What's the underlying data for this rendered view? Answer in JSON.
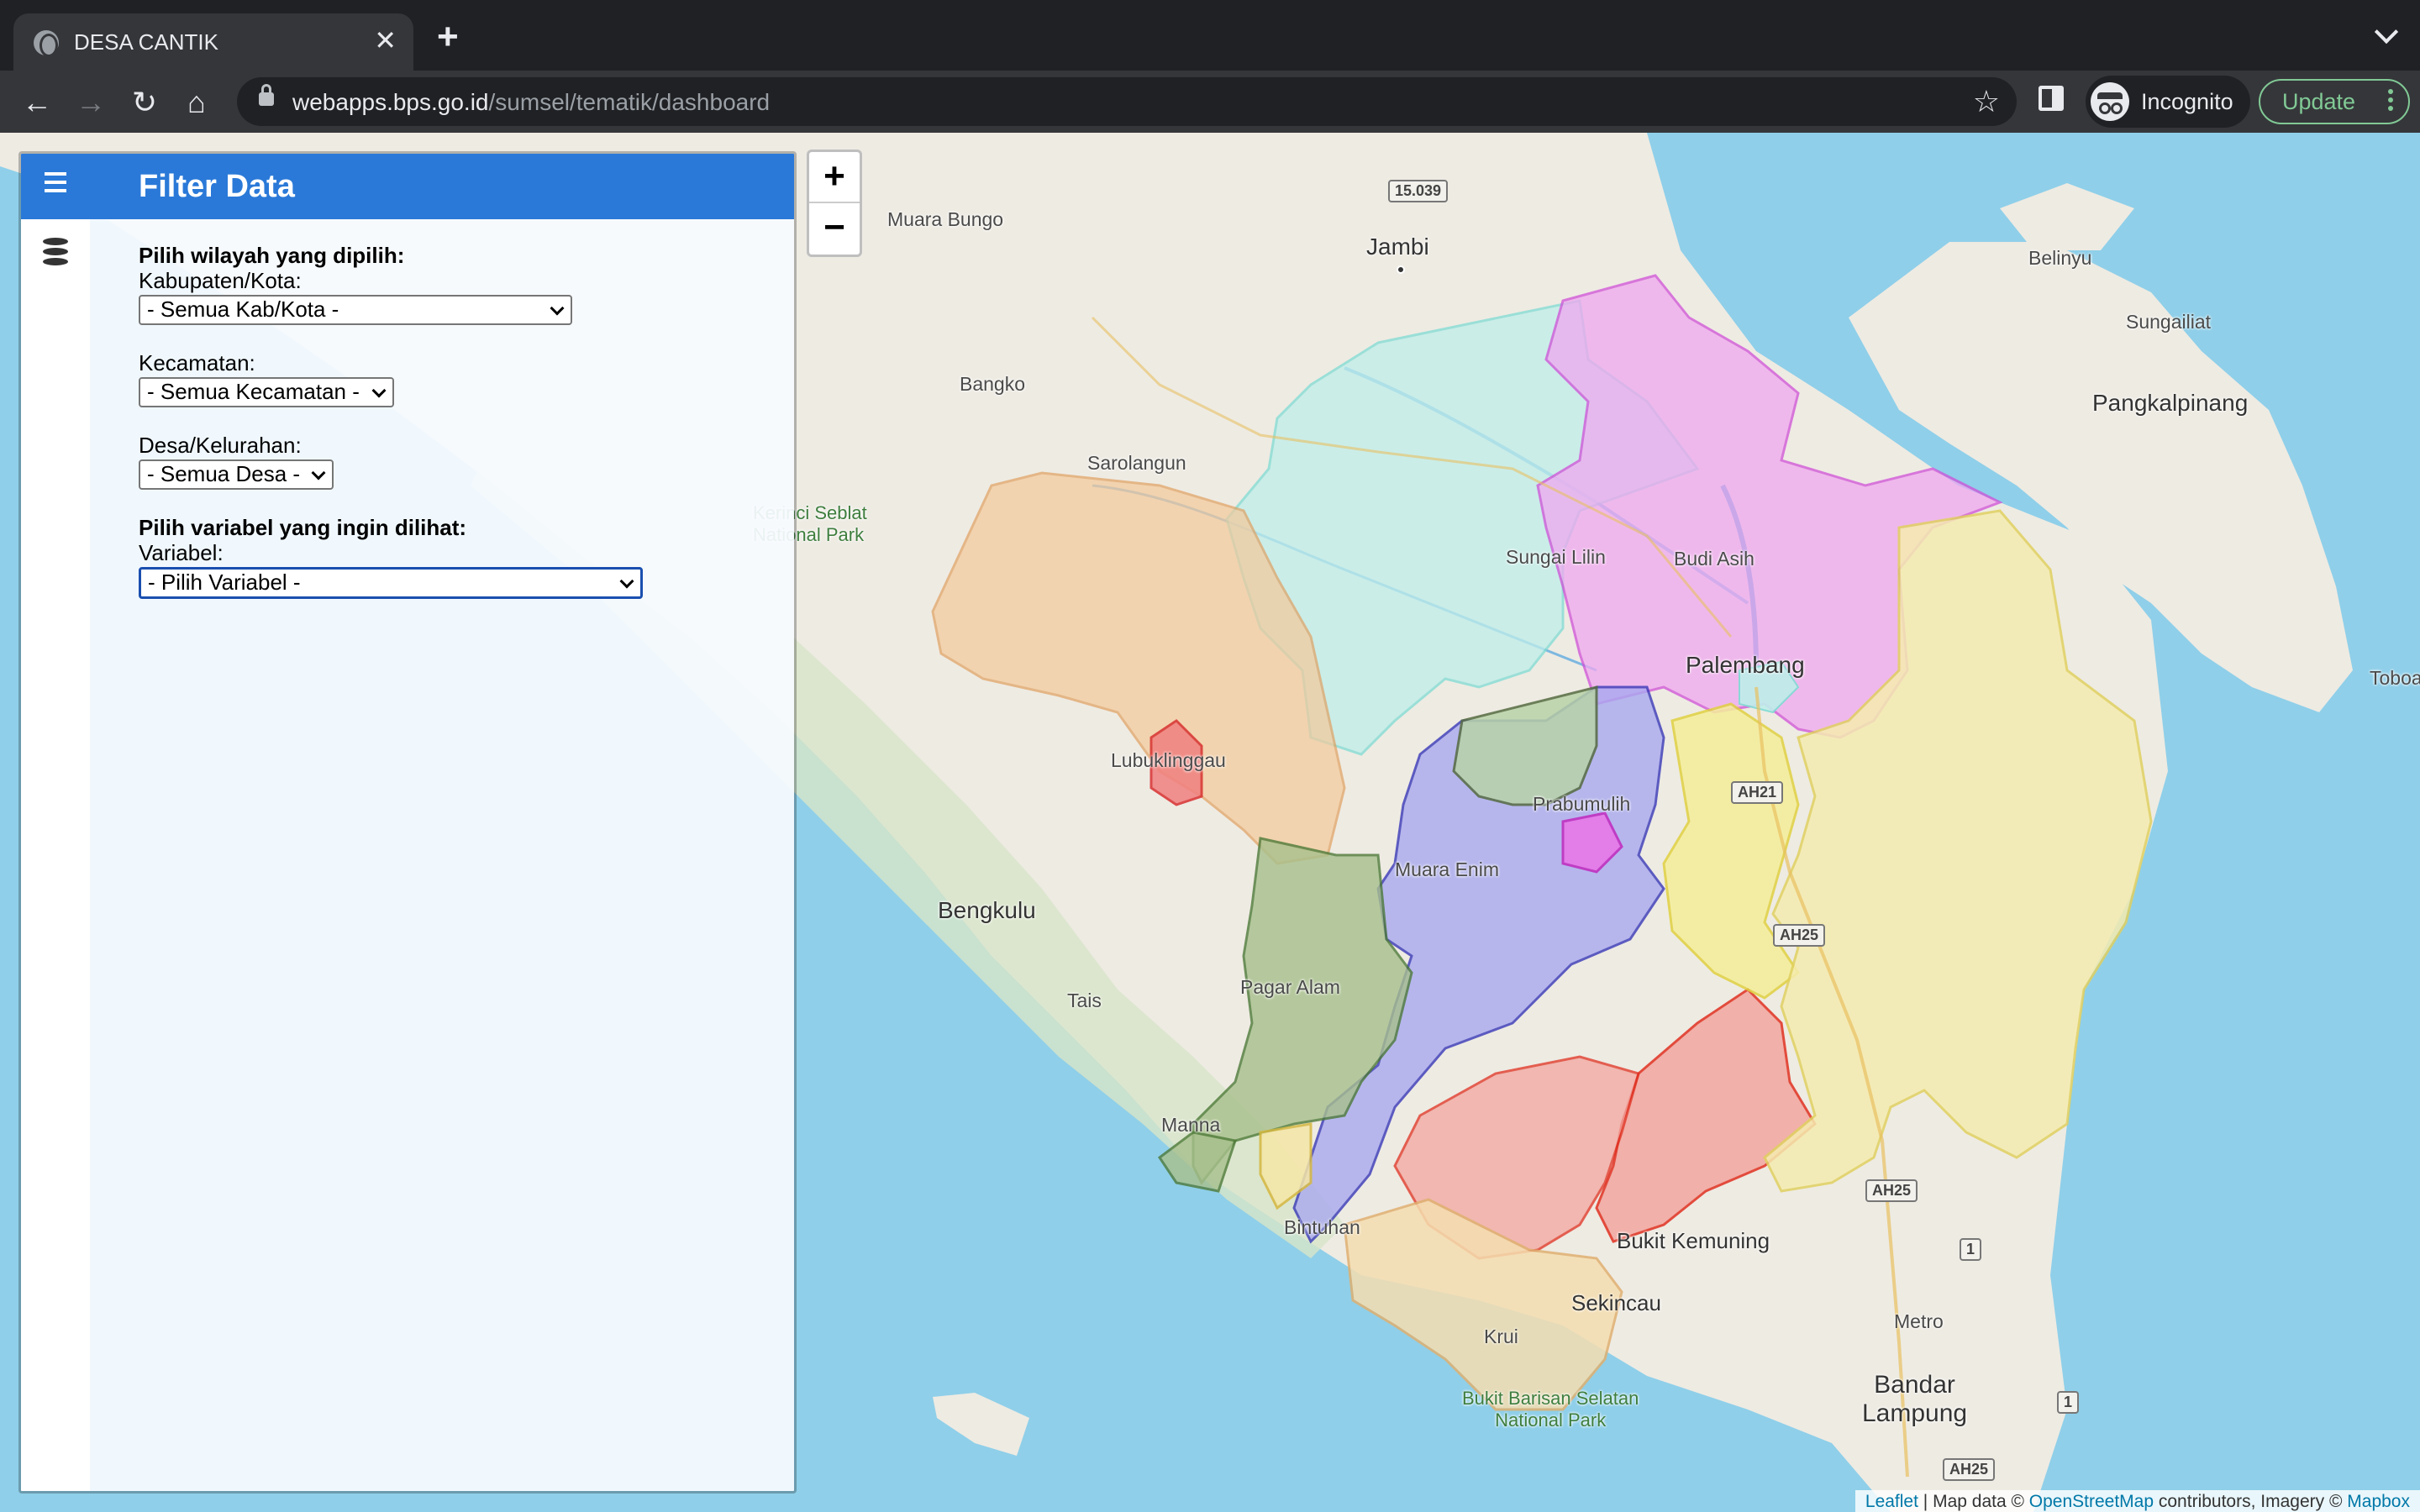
{
  "browser": {
    "tab_title": "DESA CANTIK",
    "url_host": "webapps.bps.go.id",
    "url_path": "/sumsel/tematik/dashboard",
    "incognito_label": "Incognito",
    "update_label": "Update"
  },
  "sidebar": {
    "header": "Filter Data",
    "region_heading": "Pilih wilayah yang dipilih:",
    "kab_label": "Kabupaten/Kota:",
    "kab_value": "- Semua Kab/Kota -",
    "kec_label": "Kecamatan:",
    "kec_value": "- Semua Kecamatan -",
    "desa_label": "Desa/Kelurahan:",
    "desa_value": "- Semua Desa -",
    "variable_heading": "Pilih variabel yang ingin dilihat:",
    "var_label": "Variabel:",
    "var_value": "- Pilih Variabel -"
  },
  "map": {
    "zoom_in": "+",
    "zoom_out": "−",
    "labels": {
      "jambi": "Jambi",
      "muara_bungo": "Muara Bungo",
      "bangko": "Bangko",
      "sarolangun": "Sarolangun",
      "kerinci": "Kerinci Seblat\nNational Park",
      "sungai_lilin": "Sungai Lilin",
      "budi_asih": "Budi Asih",
      "palembang": "Palembang",
      "lubuklinggau": "Lubuklinggau",
      "prabumulih": "Prabumulih",
      "muara_enim": "Muara Enim",
      "bengkulu": "Bengkulu",
      "pagar_alam": "Pagar Alam",
      "tais": "Tais",
      "manna": "Manna",
      "bintuhan": "Bintuhan",
      "bukit_kemuning": "Bukit Kemuning",
      "sekincau": "Sekincau",
      "krui": "Krui",
      "bukit_barisan": "Bukit Barisan Selatan\nNational Park",
      "metro": "Metro",
      "bandar_lampung": "Bandar\nLampung",
      "belinyu": "Belinyu",
      "sungailiat": "Sungailiat",
      "pangkalpinang": "Pangkalpinang",
      "toboali": "Toboali"
    },
    "road_shields": {
      "r15039": "15.039",
      "ah21": "AH21",
      "ah25a": "AH25",
      "ah25b": "AH25",
      "ah25c": "AH25",
      "r1a": "1",
      "r1b": "1"
    },
    "attribution": {
      "leaflet": "Leaflet",
      "sep": " | Map data © ",
      "osm": "OpenStreetMap",
      "mid": " contributors, Imagery © ",
      "mapbox": "Mapbox"
    }
  }
}
